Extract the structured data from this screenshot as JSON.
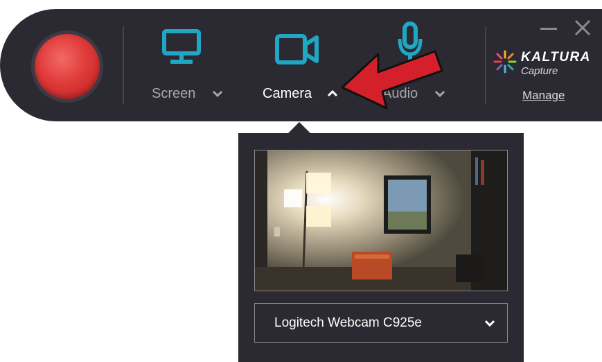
{
  "toolbar": {
    "screen_label": "Screen",
    "camera_label": "Camera",
    "audio_label": "Audio",
    "accent_color": "#1fa7c4",
    "record_color": "#e03a3a"
  },
  "brand": {
    "name": "KALTURA",
    "product": "Capture",
    "manage_label": "Manage"
  },
  "camera_popup": {
    "device_selected": "Logitech Webcam C925e"
  },
  "icons": {
    "screen": "monitor-icon",
    "camera": "video-camera-icon",
    "audio": "microphone-icon",
    "minimize": "minimize-icon",
    "close": "close-icon"
  }
}
